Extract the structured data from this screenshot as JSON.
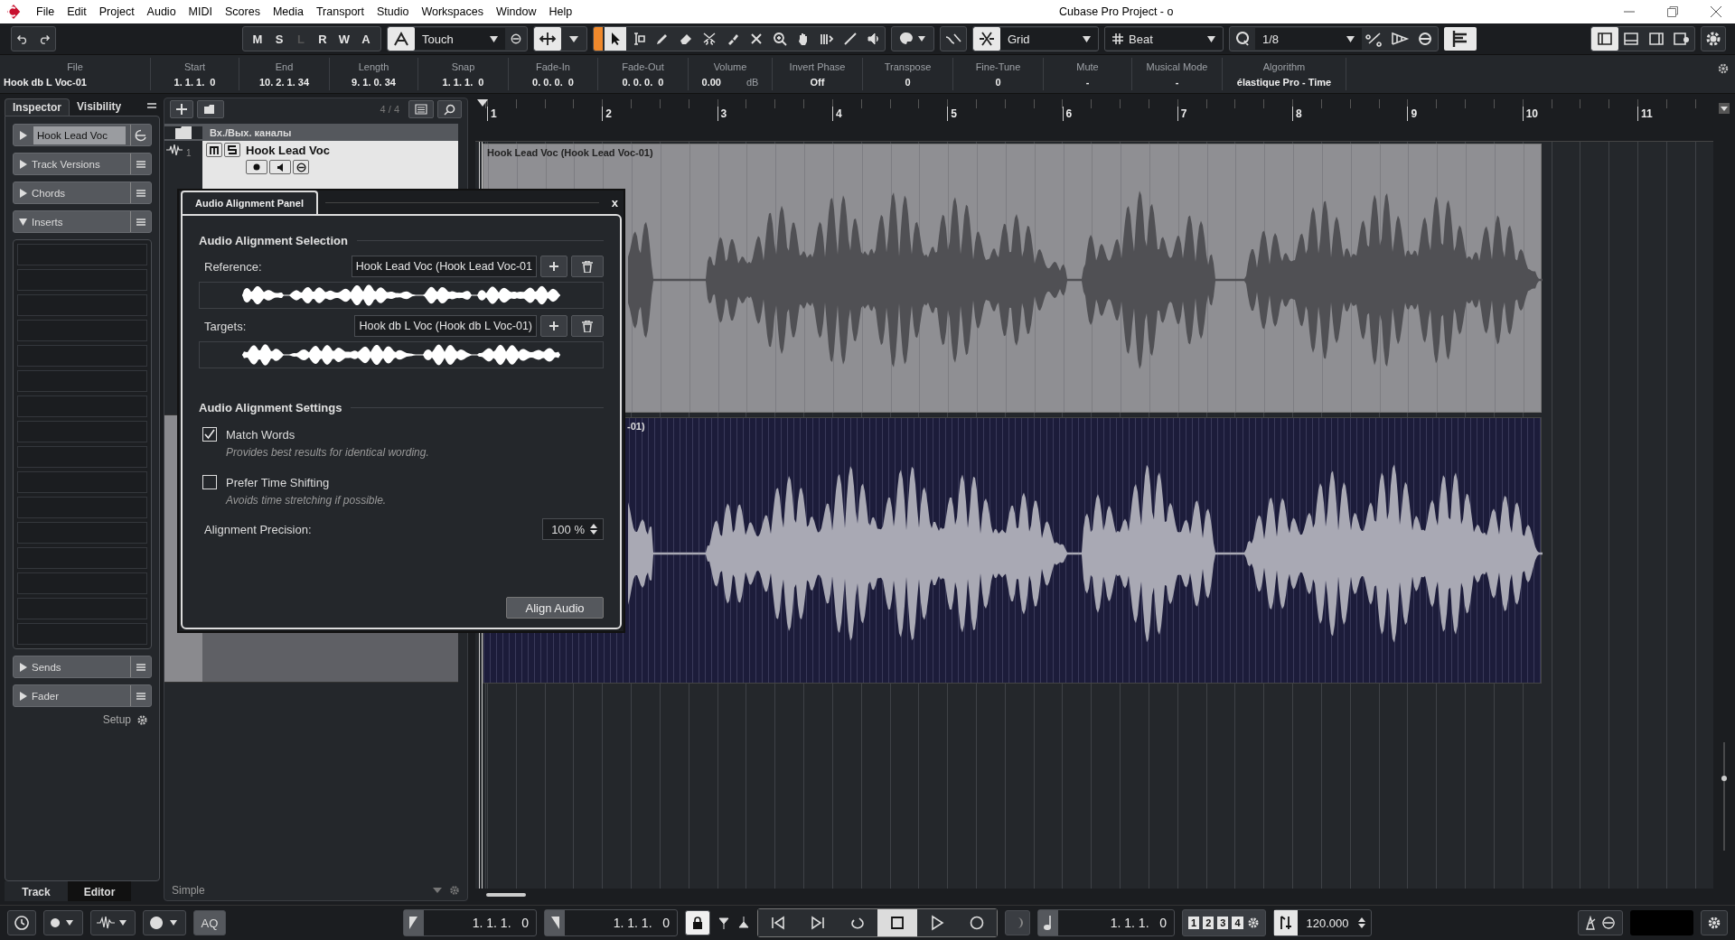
{
  "window": {
    "title": "Cubase Pro Project - o"
  },
  "menu": [
    "File",
    "Edit",
    "Project",
    "Audio",
    "MIDI",
    "Scores",
    "Media",
    "Transport",
    "Studio",
    "Workspaces",
    "Window",
    "Help"
  ],
  "toolbar": {
    "mode_buttons": [
      {
        "label": "M",
        "disabled": false
      },
      {
        "label": "S",
        "disabled": false
      },
      {
        "label": "L",
        "disabled": true
      },
      {
        "label": "R",
        "disabled": false
      },
      {
        "label": "W",
        "disabled": false
      },
      {
        "label": "A",
        "disabled": false
      }
    ],
    "automation_mode": "Touch",
    "tools": [
      {
        "kind": "select",
        "selected": true
      },
      {
        "kind": "range",
        "selected": false
      },
      {
        "kind": "draw",
        "selected": false
      },
      {
        "kind": "erase",
        "selected": false
      },
      {
        "kind": "split",
        "selected": false
      },
      {
        "kind": "glue",
        "selected": false
      },
      {
        "kind": "mute",
        "selected": false
      },
      {
        "kind": "zoom",
        "selected": false
      },
      {
        "kind": "hand",
        "selected": false
      },
      {
        "kind": "comp",
        "selected": false
      },
      {
        "kind": "line",
        "selected": false
      },
      {
        "kind": "speaker",
        "selected": false
      }
    ],
    "snap_type": "Grid",
    "grid_type": "Beat",
    "quantize": "1/8"
  },
  "info_line": [
    {
      "label": "File",
      "value": "Hook db L Voc-01"
    },
    {
      "label": "Start",
      "value": "1. 1. 1.  0"
    },
    {
      "label": "End",
      "value": "10. 2. 1. 34"
    },
    {
      "label": "Length",
      "value": "9. 1. 0. 34"
    },
    {
      "label": "Snap",
      "value": "1. 1. 1.  0"
    },
    {
      "label": "Fade-In",
      "value": "0. 0. 0.  0"
    },
    {
      "label": "Fade-Out",
      "value": "0. 0. 0.  0"
    },
    {
      "label": "Volume",
      "value": "0.00",
      "unit": "dB"
    },
    {
      "label": "Invert Phase",
      "value": "Off"
    },
    {
      "label": "Transpose",
      "value": "0"
    },
    {
      "label": "Fine-Tune",
      "value": "0"
    },
    {
      "label": "Mute",
      "value": "-"
    },
    {
      "label": "Musical Mode",
      "value": "-"
    },
    {
      "label": "Algorithm",
      "value": "élastique Pro - Time"
    }
  ],
  "inspector": {
    "tabs": [
      {
        "label": "Inspector",
        "selected": true
      },
      {
        "label": "Visibility",
        "selected": false
      }
    ],
    "sections": [
      {
        "label": "Hook Lead Voc",
        "kind": "track",
        "expanded": false
      },
      {
        "label": "Track Versions",
        "kind": "section",
        "expanded": false
      },
      {
        "label": "Chords",
        "kind": "section",
        "expanded": false
      },
      {
        "label": "Inserts",
        "kind": "section",
        "expanded": true
      },
      {
        "label": "Sends",
        "kind": "section",
        "expanded": false
      },
      {
        "label": "Fader",
        "kind": "section",
        "expanded": false
      }
    ],
    "setup": "Setup",
    "bottom_tabs": [
      {
        "label": "Track",
        "selected": true
      },
      {
        "label": "Editor",
        "selected": false
      }
    ]
  },
  "track_list": {
    "count": "4 / 4",
    "folder": "Вх./Вых. каналы",
    "tracks": [
      {
        "number": "1",
        "name": "Hook Lead Voc",
        "selected": true
      },
      {
        "selected": false
      }
    ],
    "preset": "Simple"
  },
  "ruler": {
    "bars": [
      "1",
      "2",
      "3",
      "4",
      "5",
      "6",
      "7",
      "8",
      "9",
      "10",
      "11"
    ]
  },
  "events": [
    {
      "label": "Hook Lead Voc (Hook Lead Voc-01)",
      "selected": false
    },
    {
      "label": "-01)",
      "selected": true
    }
  ],
  "panel": {
    "title": "Audio Alignment Panel",
    "close": "x",
    "selection_heading": "Audio Alignment Selection",
    "reference_label": "Reference:",
    "reference_value": "Hook Lead Voc (Hook Lead Voc-01",
    "targets_label": "Targets:",
    "targets_value": "Hook db L Voc (Hook db L Voc-01)",
    "settings_heading": "Audio Alignment Settings",
    "options": [
      {
        "label": "Match Words",
        "hint": "Provides best results for identical wording.",
        "checked": true
      },
      {
        "label": "Prefer Time Shifting",
        "hint": "Avoids time stretching if possible.",
        "checked": false
      }
    ],
    "precision_label": "Alignment Precision:",
    "precision_value": "100 %",
    "align_button": "Align Audio"
  },
  "transport": {
    "aq": "AQ",
    "left_locator": "1. 1. 1.   0",
    "right_locator": "1. 1. 1.   0",
    "controls": [
      {
        "kind": "start",
        "on": false
      },
      {
        "kind": "end",
        "on": false
      },
      {
        "kind": "cycle",
        "on": false
      },
      {
        "kind": "stop",
        "on": true
      },
      {
        "kind": "play",
        "on": false
      },
      {
        "kind": "record",
        "on": false
      }
    ],
    "position": "1. 1. 1.   0",
    "markers": [
      "1",
      "2",
      "3",
      "4"
    ],
    "tempo": "120.000"
  }
}
